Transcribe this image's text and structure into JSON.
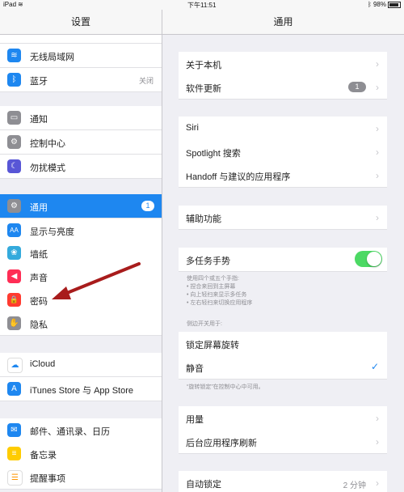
{
  "status": {
    "carrier": "iPad",
    "time": "下午11:51",
    "battery": "98%"
  },
  "left": {
    "title": "设置",
    "items": [
      {
        "label": "无线局域网",
        "value": "",
        "color": "#1e87f0",
        "icon": "wifi-icon",
        "glyph": "≋"
      },
      {
        "label": "蓝牙",
        "value": "关闭",
        "color": "#1e87f0",
        "icon": "bluetooth-icon",
        "glyph": "ᛒ"
      },
      {
        "label": "通知",
        "value": "",
        "color": "#8e8e93",
        "icon": "notifications-icon",
        "glyph": "▭"
      },
      {
        "label": "控制中心",
        "value": "",
        "color": "#8e8e93",
        "icon": "control-center-icon",
        "glyph": "⚙"
      },
      {
        "label": "勿扰模式",
        "value": "",
        "color": "#5856d6",
        "icon": "moon-icon",
        "glyph": "☾"
      },
      {
        "label": "通用",
        "value": "",
        "color": "#8e8e93",
        "icon": "gear-icon",
        "glyph": "⚙",
        "badge": "1"
      },
      {
        "label": "显示与亮度",
        "value": "",
        "color": "#1e87f0",
        "icon": "display-icon",
        "glyph": "AA"
      },
      {
        "label": "墙纸",
        "value": "",
        "color": "#34aadc",
        "icon": "wallpaper-icon",
        "glyph": "❀"
      },
      {
        "label": "声音",
        "value": "",
        "color": "#ff2d55",
        "icon": "sound-icon",
        "glyph": "◀"
      },
      {
        "label": "密码",
        "value": "",
        "color": "#ff3b30",
        "icon": "lock-icon",
        "glyph": "🔒"
      },
      {
        "label": "隐私",
        "value": "",
        "color": "#8e8e93",
        "icon": "hand-icon",
        "glyph": "✋"
      },
      {
        "label": "iCloud",
        "value": "",
        "color": "#1e87f0",
        "icon": "cloud-icon",
        "glyph": "☁"
      },
      {
        "label": "iTunes Store 与 App Store",
        "value": "",
        "color": "#1e87f0",
        "icon": "app-store-icon",
        "glyph": "A"
      },
      {
        "label": "邮件、通讯录、日历",
        "value": "",
        "color": "#1e87f0",
        "icon": "mail-icon",
        "glyph": "✉"
      },
      {
        "label": "备忘录",
        "value": "",
        "color": "#ffcc00",
        "icon": "notes-icon",
        "glyph": "≡"
      },
      {
        "label": "提醒事项",
        "value": "",
        "color": "#ffffff",
        "icon": "reminders-icon",
        "glyph": "☰"
      }
    ]
  },
  "right": {
    "title": "通用",
    "items": [
      {
        "label": "关于本机"
      },
      {
        "label": "软件更新",
        "badge": "1"
      },
      {
        "label": "Siri"
      },
      {
        "label": "Spotlight 搜索"
      },
      {
        "label": "Handoff 与建议的应用程序"
      },
      {
        "label": "辅助功能"
      },
      {
        "label": "多任务手势",
        "toggle": true
      },
      {
        "label": "锁定屏幕旋转"
      },
      {
        "label": "静音",
        "check": true
      },
      {
        "label": "用量"
      },
      {
        "label": "后台应用程序刷新"
      },
      {
        "label": "自动锁定",
        "value": "2 分钟"
      }
    ],
    "multitask_note": [
      "使用四个或五个手指:",
      "• 捏合来回到主屏幕",
      "• 向上轻扫来显示多任务",
      "• 左右轻扫来切换应用程序"
    ],
    "side_switch_header": "侧边开关用于:",
    "rotation_note": "“旋转锁定”在控制中心中可用。"
  }
}
